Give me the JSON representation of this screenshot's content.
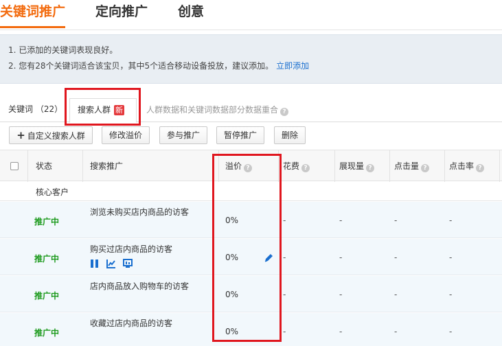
{
  "top_tabs": [
    {
      "label": "关键词推广",
      "active": true
    },
    {
      "label": "定向推广",
      "active": false
    },
    {
      "label": "创意",
      "active": false
    }
  ],
  "notice": {
    "line1": "1. 已添加的关键词表现良好。",
    "line2": "2. 您有28个关键词适合该宝贝，其中5个适合移动设备投放，建议添加。",
    "link": "立即添加"
  },
  "sub_tabs": {
    "keywords_label": "关键词 （22）",
    "audience_label": "搜索人群",
    "new_badge": "新",
    "note": "人群数据和关键词数据部分数据重合"
  },
  "toolbar": {
    "custom_label": "自定义搜索人群",
    "modify_label": "修改溢价",
    "join_label": "参与推广",
    "pause_label": "暂停推广",
    "delete_label": "删除"
  },
  "table": {
    "headers": {
      "status": "状态",
      "audience": "搜索推广",
      "premium": "溢价",
      "cost": "花费",
      "impressions": "展现量",
      "clicks": "点击量",
      "ctr": "点击率"
    },
    "group_label": "核心客户",
    "rows": [
      {
        "status": "推广中",
        "audience": "浏览未购买店内商品的访客",
        "premium": "0%",
        "cost": "-",
        "impressions": "-",
        "clicks": "-",
        "ctr": "-"
      },
      {
        "status": "推广中",
        "audience": "购买过店内商品的访客",
        "premium": "0%",
        "cost": "-",
        "impressions": "-",
        "clicks": "-",
        "ctr": "-"
      },
      {
        "status": "推广中",
        "audience": "店内商品放入购物车的访客",
        "premium": "0%",
        "cost": "-",
        "impressions": "-",
        "clicks": "-",
        "ctr": "-"
      },
      {
        "status": "推广中",
        "audience": "收藏过店内商品的访客",
        "premium": "0%",
        "cost": "-",
        "impressions": "-",
        "clicks": "-",
        "ctr": "-"
      }
    ]
  },
  "colors": {
    "accent_orange": "#f36b0e",
    "status_green": "#1d9a1d",
    "link_blue": "#1a6fcf",
    "highlight_red": "#e0161e"
  },
  "icons": [
    "plus-icon",
    "help-icon",
    "pause-icon",
    "trend-chart-icon",
    "report-icon",
    "pencil-edit-icon"
  ]
}
